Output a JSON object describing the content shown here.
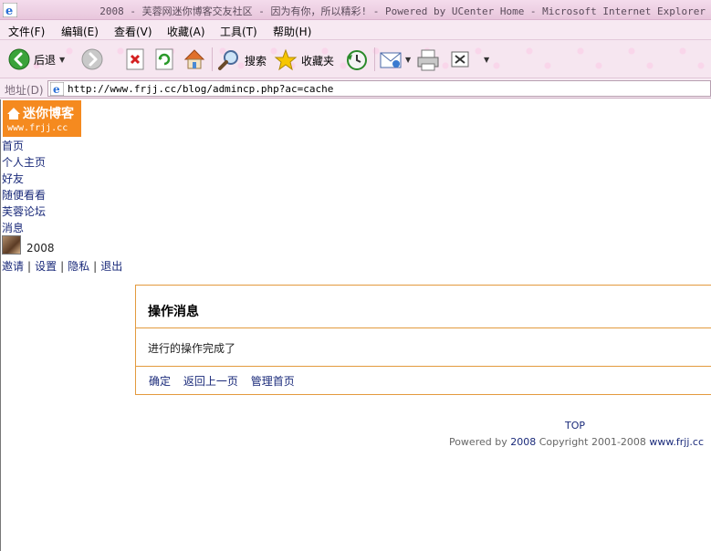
{
  "window": {
    "title": "2008 - 芙蓉网迷你博客交友社区 - 因为有你，所以精彩! - Powered by UCenter Home - Microsoft Internet Explorer"
  },
  "menubar": {
    "items": [
      {
        "label": "文件(F)"
      },
      {
        "label": "编辑(E)"
      },
      {
        "label": "查看(V)"
      },
      {
        "label": "收藏(A)"
      },
      {
        "label": "工具(T)"
      },
      {
        "label": "帮助(H)"
      }
    ]
  },
  "toolbar": {
    "back_label": "后退",
    "search_label": "搜索",
    "favorites_label": "收藏夹"
  },
  "address": {
    "label": "地址(D)",
    "url": "http://www.frjj.cc/blog/admincp.php?ac=cache"
  },
  "logo": {
    "title": "迷你博客",
    "subtitle": "www.frjj.cc"
  },
  "nav": {
    "items": [
      "首页",
      "个人主页",
      "好友",
      "随便看看",
      "芙蓉论坛",
      "消息"
    ]
  },
  "user": {
    "name": "2008"
  },
  "user_links": {
    "invite": "邀请",
    "settings": "设置",
    "privacy": "隐私",
    "logout": "退出",
    "separator": "|"
  },
  "message": {
    "title": "操作消息",
    "body": "进行的操作完成了",
    "confirm": "确定",
    "back": "返回上一页",
    "admin_home": "管理首页"
  },
  "footer": {
    "top_link": "TOP",
    "powered_by": "Powered by",
    "powered_link": "2008",
    "copyright": "Copyright 2001-2008",
    "site_link": "www.frjj.cc"
  },
  "colors": {
    "accent_orange": "#f58a1f",
    "link_blue": "#1a2a7a",
    "border_orange": "#e39a3e",
    "chrome_pink": "#f6e6f0"
  }
}
